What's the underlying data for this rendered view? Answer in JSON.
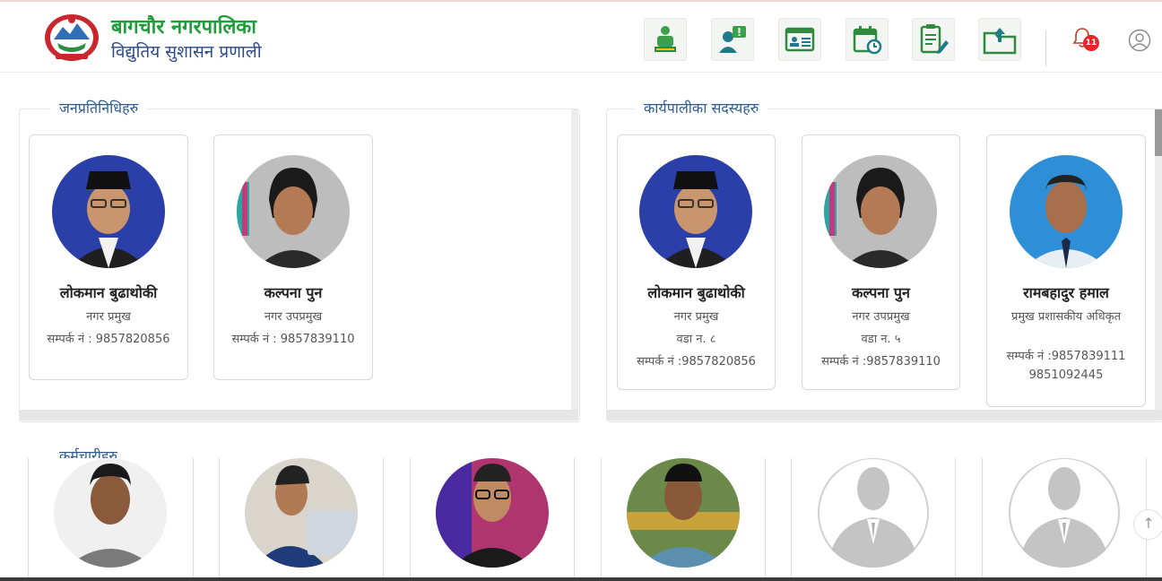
{
  "header": {
    "title": "बागचौर नगरपालिका",
    "subtitle": "विद्युतिय सुशासन प्रणाली",
    "notification_count": "11",
    "nav_icons": [
      "hello-mayor-icon",
      "feedback-icon",
      "id-card-icon",
      "calendar-clock-icon",
      "notepad-edit-icon",
      "upload-folder-icon"
    ]
  },
  "representatives": {
    "legend": "जनप्रतिनिधिहरु",
    "cards": [
      {
        "name": "लोकमान बुढाथोकी",
        "post": "नगर प्रमुख",
        "contact": "सम्पर्क नं : 9857820856"
      },
      {
        "name": "कल्पना पुन",
        "post": "नगर उपप्रमुख",
        "contact": "सम्पर्क नं : 9857839110"
      }
    ]
  },
  "executives": {
    "legend": "कार्यपालीका सदस्यहरु",
    "cards": [
      {
        "name": "लोकमान बुढाथोकी",
        "post": "नगर प्रमुख",
        "ward": "वडा न. ८",
        "contact": "सम्पर्क नं :9857820856",
        "contact2": ""
      },
      {
        "name": "कल्पना पुन",
        "post": "नगर उपप्रमुख",
        "ward": "वडा न. ५",
        "contact": "सम्पर्क नं :9857839110",
        "contact2": ""
      },
      {
        "name": "रामबहादुर हमाल",
        "post": "प्रमुख प्रशासकीय अधिकृत",
        "ward": "",
        "contact": "सम्पर्क नं :9857839111",
        "contact2": "9851092445"
      }
    ]
  },
  "staff": {
    "legend": "कर्मचारीहरु"
  },
  "colors": {
    "brand_green": "#1e9e3a",
    "brand_blue": "#2c4a8a",
    "legend_blue": "#2e5c8f",
    "badge_red": "#e4262b"
  }
}
